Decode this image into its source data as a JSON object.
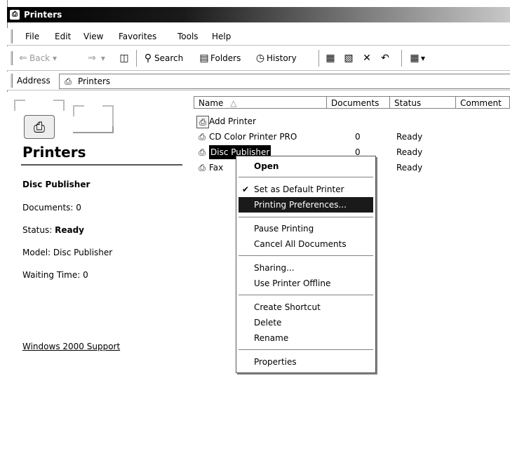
{
  "window": {
    "title": "Printers"
  },
  "menu": [
    "File",
    "Edit",
    "View",
    "Favorites",
    "Tools",
    "Help"
  ],
  "toolbar": {
    "back": "Back",
    "search": "Search",
    "folders": "Folders",
    "history": "History"
  },
  "address": {
    "label": "Address",
    "value": "Printers"
  },
  "left_pane": {
    "title": "Printers",
    "selected_name": "Disc Publisher",
    "documents": "Documents: 0",
    "status_label": "Status: ",
    "status_value": "Ready",
    "model": "Model: Disc Publisher",
    "waiting": "Waiting Time: 0",
    "support_link": "Windows 2000 Support"
  },
  "columns": [
    "Name",
    "Documents",
    "Status",
    "Comment"
  ],
  "rows": [
    {
      "name": "Add Printer",
      "documents": "",
      "status": ""
    },
    {
      "name": "CD Color Printer PRO",
      "documents": "0",
      "status": "Ready"
    },
    {
      "name": "Disc Publisher",
      "documents": "0",
      "status": "Ready"
    },
    {
      "name": "Fax",
      "documents": "",
      "status": "Ready"
    }
  ],
  "context_menu": {
    "open": "Open",
    "set_default": "Set as Default Printer",
    "printing_prefs": "Printing Preferences...",
    "pause": "Pause Printing",
    "cancel_all": "Cancel All Documents",
    "sharing": "Sharing...",
    "offline": "Use Printer Offline",
    "shortcut": "Create Shortcut",
    "delete": "Delete",
    "rename": "Rename",
    "properties": "Properties"
  }
}
